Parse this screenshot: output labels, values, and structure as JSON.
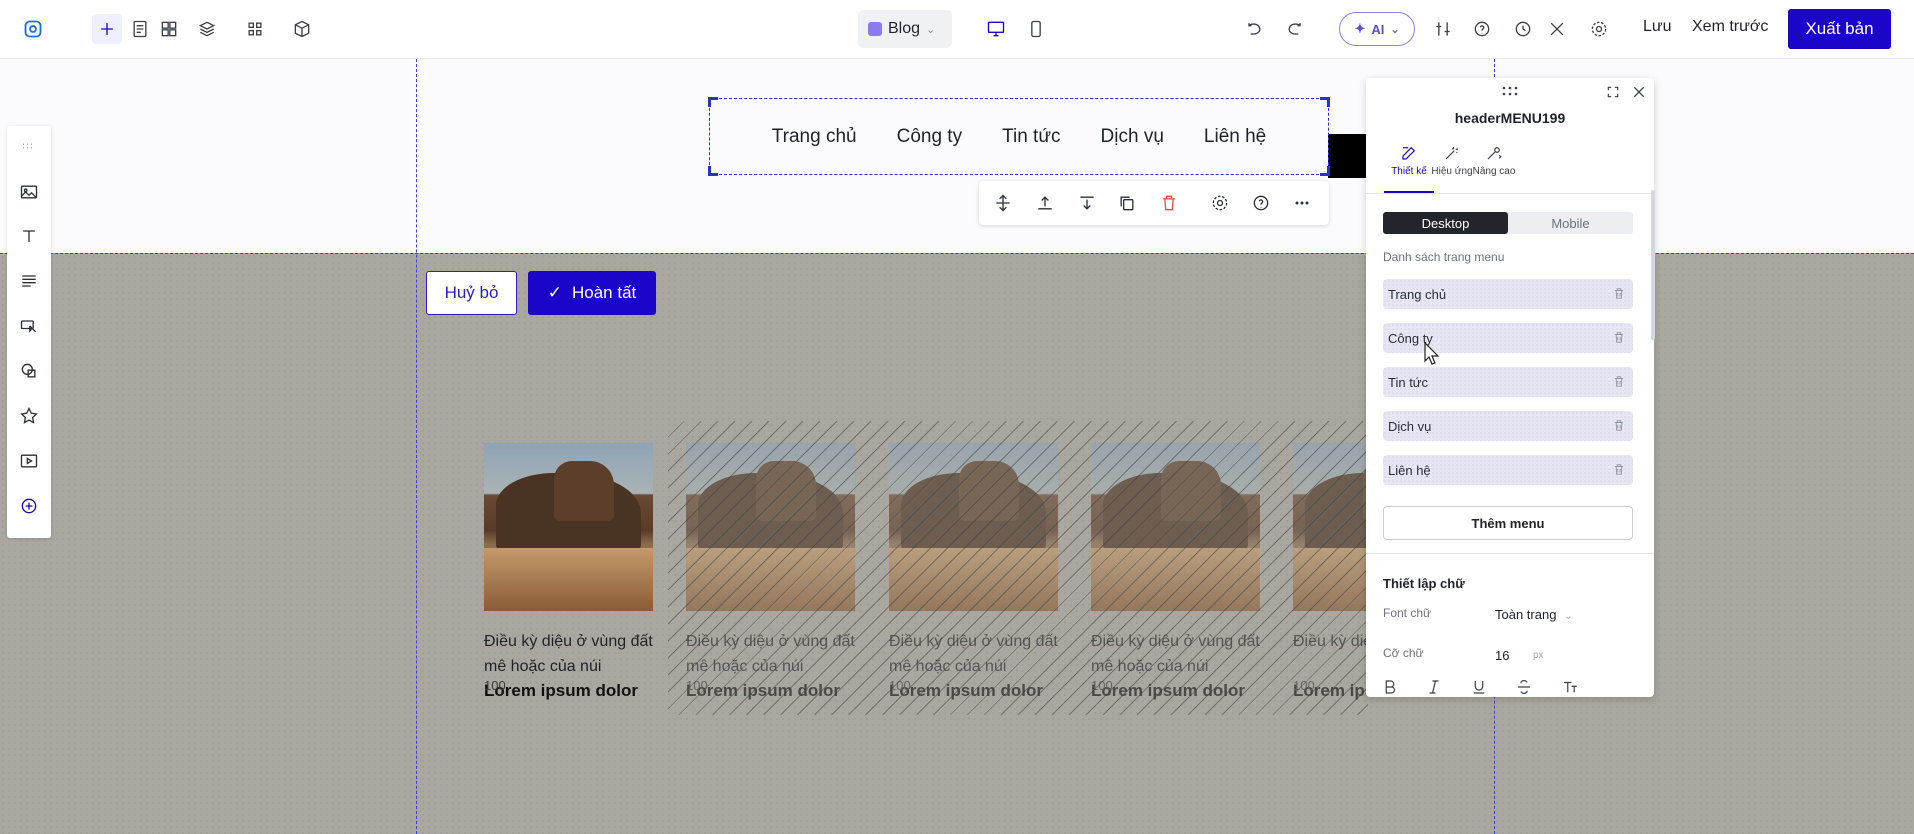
{
  "topbar": {
    "page_select": "Blog",
    "ai_label": "AI",
    "save_label": "Lưu",
    "preview_label": "Xem trước",
    "publish_label": "Xuất bản"
  },
  "canvas": {
    "nav_items": [
      "Trang chủ",
      "Công ty",
      "Tin tức",
      "Dịch vụ",
      "Liên hệ"
    ],
    "cancel_label": "Huỷ bỏ",
    "done_label": "Hoàn tất",
    "cards": [
      {
        "title": "Điều kỳ diệu ở vùng đất mê hoặc của núi",
        "subtitle": "Lorem ipsum dolor",
        "number": "100"
      },
      {
        "title": "Điều kỳ diệu ở vùng đất mê hoặc của núi",
        "subtitle": "Lorem ipsum dolor",
        "number": "100"
      },
      {
        "title": "Điều kỳ diệu ở vùng đất mê hoặc của núi",
        "subtitle": "Lorem ipsum dolor",
        "number": "100"
      },
      {
        "title": "Điều kỳ diệu ở vùng đất mê hoặc của núi",
        "subtitle": "Lorem ipsum dolor",
        "number": "100"
      },
      {
        "title": "Điều kỳ diệu ở vùng",
        "subtitle": "Lorem ipsum dolor",
        "number": "100"
      }
    ]
  },
  "panel": {
    "title": "headerMENU199",
    "tabs": [
      "Thiết kế",
      "Hiệu ứng",
      "Nâng cao"
    ],
    "device_desktop": "Desktop",
    "device_mobile": "Mobile",
    "menu_list_label": "Danh sách trang menu",
    "menu_items": [
      "Trang chủ",
      "Công ty",
      "Tin tức",
      "Dịch vụ",
      "Liên hệ"
    ],
    "add_menu_label": "Thêm menu",
    "text_settings_title": "Thiết lập chữ",
    "font_label": "Font chữ",
    "font_value": "Toàn trang",
    "size_label": "Cỡ chữ",
    "size_value": "16",
    "size_unit": "px"
  },
  "colors": {
    "accent": "#1a05c9",
    "canvas_gray": "#a9a79f",
    "guide": "#3a44d8"
  }
}
